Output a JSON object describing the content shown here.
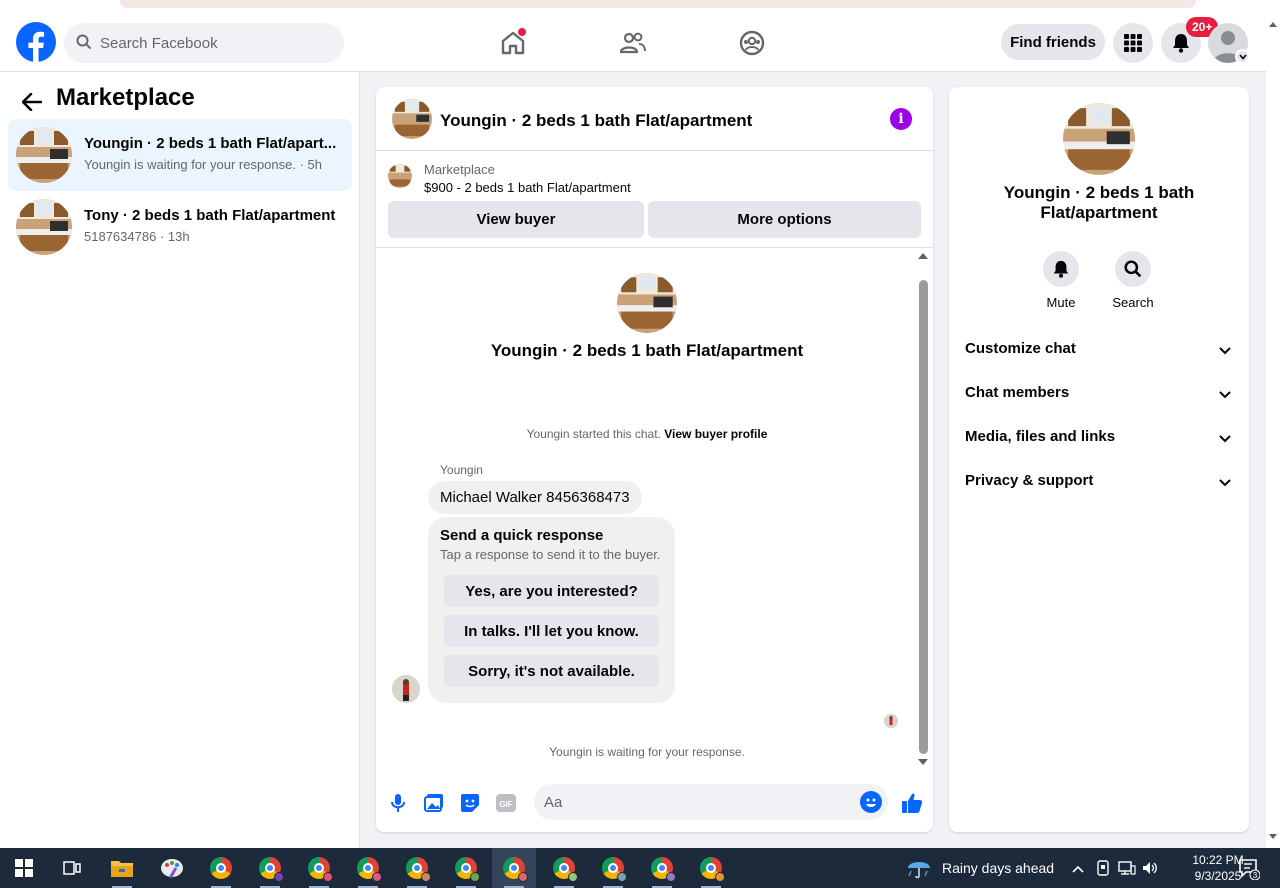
{
  "topnav": {
    "search_placeholder": "Search Facebook",
    "find_friends": "Find friends",
    "notification_count": "20+"
  },
  "left": {
    "title": "Marketplace",
    "conversations": [
      {
        "title": "Youngin · 2 beds 1 bath Flat/apart...",
        "subtitle": "Youngin is waiting for your response. · 5h"
      },
      {
        "title": "Tony · 2 beds 1 bath Flat/apartment",
        "subtitle": "5187634786 · 13h"
      }
    ]
  },
  "chat": {
    "header_title": "Youngin · 2 beds 1 bath Flat/apartment",
    "listing_kicker": "Marketplace",
    "listing_price": "$900 - 2 beds 1 bath Flat/apartment",
    "view_buyer": "View buyer",
    "more_options": "More options",
    "intro_title": "Youngin · 2 beds 1 bath Flat/apartment",
    "started_text": "Youngin started this chat.",
    "view_buyer_profile": "View buyer profile",
    "sender_name": "Youngin",
    "message": "Michael Walker 8456368473",
    "quick_title": "Send a quick response",
    "quick_subtitle": "Tap a response to send it to the buyer.",
    "quick_replies": [
      "Yes, are you interested?",
      "In talks. I'll let you know.",
      "Sorry, it's not available."
    ],
    "waiting_text": "Youngin is waiting for your response.",
    "composer_placeholder": "Aa"
  },
  "right": {
    "title": "Youngin · 2 beds 1 bath Flat/apartment",
    "actions": [
      "Mute",
      "Search"
    ],
    "sections": [
      "Customize chat",
      "Chat members",
      "Media, files and links",
      "Privacy & support"
    ]
  },
  "taskbar": {
    "weather": "Rainy days ahead",
    "time": "10:22 PM",
    "date": "9/3/2025",
    "notification_count": "3"
  },
  "colors": {
    "brand": "#0866ff",
    "info": "#9d00e6",
    "badge": "#e41e3f"
  }
}
